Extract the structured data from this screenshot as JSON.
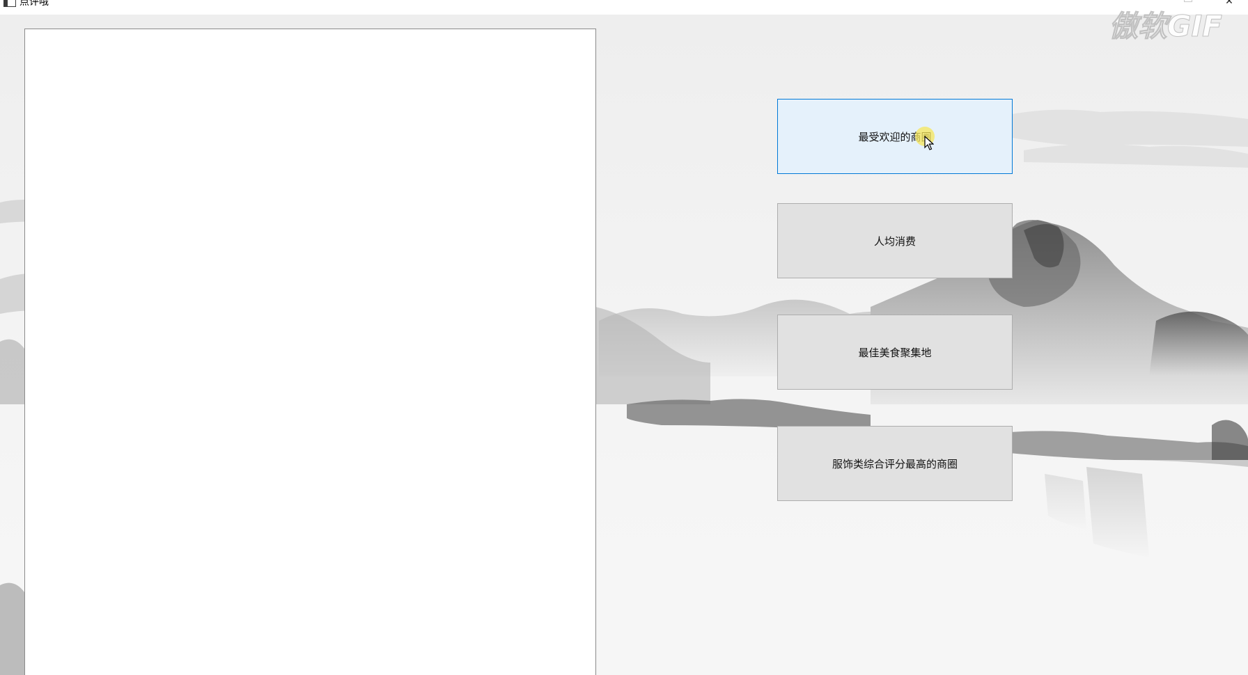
{
  "window": {
    "title": "点评哦",
    "controls": {
      "minimize_icon": "minimize-icon",
      "maximize_icon": "maximize-icon",
      "close_label": "✕"
    }
  },
  "buttons": [
    {
      "label": "最受欢迎的商圈",
      "state": "hover"
    },
    {
      "label": "人均消费",
      "state": "normal"
    },
    {
      "label": "最佳美食聚集地",
      "state": "normal"
    },
    {
      "label": "服饰类综合评分最高的商圈",
      "state": "normal"
    }
  ],
  "watermark": {
    "text": "傲软GIF"
  },
  "colors": {
    "button_bg": "#e1e1e1",
    "button_hover_bg": "#e5f1fb",
    "button_hover_border": "#0078d7",
    "cursor_highlight": "#f6e65a"
  }
}
